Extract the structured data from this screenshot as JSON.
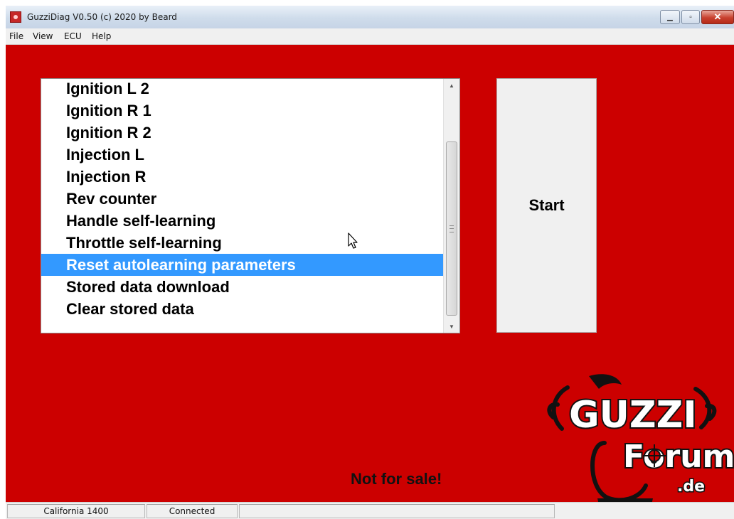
{
  "window": {
    "title": "GuzziDiag V0.50  (c) 2020 by Beard",
    "close_glyph": "✕",
    "maximize_glyph": "▫",
    "minimize_glyph": "▁"
  },
  "menu": [
    "File",
    "View",
    "ECU",
    "Help"
  ],
  "list": {
    "items": [
      "Ignition L 2",
      "Ignition R 1",
      "Ignition R 2",
      "Injection L",
      "Injection R",
      "Rev counter",
      "Handle self-learning",
      "Throttle self-learning",
      "Reset autolearning parameters",
      "Stored data download",
      "Clear stored data"
    ],
    "selected_index": 8
  },
  "start_button": {
    "label": "Start"
  },
  "notice": "Not for sale!",
  "logo": {
    "text_line1": "GUZZI",
    "text_line2": "Forum",
    "text_line3": ".de"
  },
  "status": {
    "model": "California 1400",
    "connection": "Connected",
    "extra": ""
  },
  "colors": {
    "client_background": "#cc0000",
    "selection": "#3399ff"
  },
  "icons": {
    "app": "app-icon",
    "cursor": "mouse-pointer-icon",
    "scroll_up": "scroll-up-arrow-icon",
    "scroll_down": "scroll-down-arrow-icon"
  }
}
